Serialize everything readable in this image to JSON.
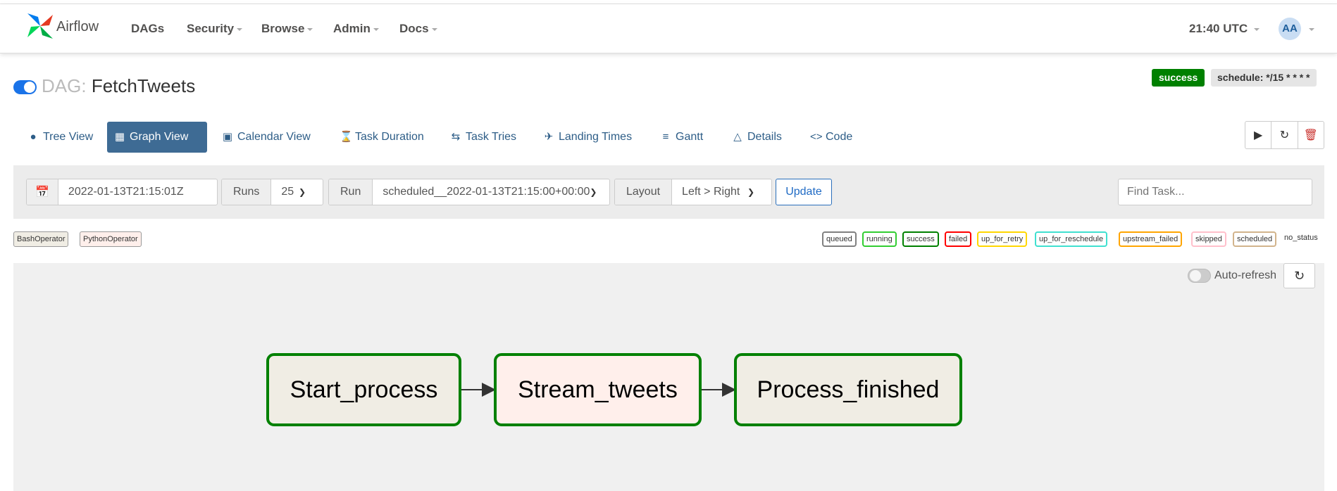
{
  "app": {
    "name": "Airflow"
  },
  "navbar": {
    "items": [
      "DAGs",
      "Security",
      "Browse",
      "Admin",
      "Docs"
    ],
    "clock": "21:40 UTC",
    "user_initials": "AA"
  },
  "dag": {
    "label": "DAG:",
    "name": "FetchTweets",
    "status": "success",
    "schedule": "schedule: */15 * * * *"
  },
  "tabs": [
    {
      "label": "Tree View",
      "icon": "tree-icon"
    },
    {
      "label": "Graph View",
      "icon": "graph-icon"
    },
    {
      "label": "Calendar View",
      "icon": "calendar-icon"
    },
    {
      "label": "Task Duration",
      "icon": "hourglass-icon"
    },
    {
      "label": "Task Tries",
      "icon": "retry-icon"
    },
    {
      "label": "Landing Times",
      "icon": "landing-icon"
    },
    {
      "label": "Gantt",
      "icon": "gantt-icon"
    },
    {
      "label": "Details",
      "icon": "warning-icon"
    },
    {
      "label": "Code",
      "icon": "code-icon"
    }
  ],
  "controls": {
    "date": "2022-01-13T21:15:01Z",
    "runs_label": "Runs",
    "runs_value": "25",
    "run_label": "Run",
    "run_value": "scheduled__2022-01-13T21:15:00+00:00",
    "layout_label": "Layout",
    "layout_value": "Left > Right",
    "update_label": "Update",
    "find_task_placeholder": "Find Task..."
  },
  "operators": [
    {
      "name": "BashOperator",
      "color": "#f0ede4"
    },
    {
      "name": "PythonOperator",
      "color": "#ffefeb"
    }
  ],
  "states": [
    {
      "name": "queued",
      "color": "#808080"
    },
    {
      "name": "running",
      "color": "#32cd32"
    },
    {
      "name": "success",
      "color": "#008000"
    },
    {
      "name": "failed",
      "color": "#ff0000"
    },
    {
      "name": "up_for_retry",
      "color": "#ffd700"
    },
    {
      "name": "up_for_reschedule",
      "color": "#40e0d0"
    },
    {
      "name": "upstream_failed",
      "color": "#ffa500"
    },
    {
      "name": "skipped",
      "color": "#ffc0cb"
    },
    {
      "name": "scheduled",
      "color": "#d2b48c"
    },
    {
      "name": "no_status",
      "color": null
    }
  ],
  "graph": {
    "auto_refresh_label": "Auto-refresh",
    "nodes": [
      {
        "label": "Start_process",
        "operator": "BashOperator",
        "state": "success"
      },
      {
        "label": "Stream_tweets",
        "operator": "PythonOperator",
        "state": "success"
      },
      {
        "label": "Process_finished",
        "operator": "BashOperator",
        "state": "success"
      }
    ]
  }
}
